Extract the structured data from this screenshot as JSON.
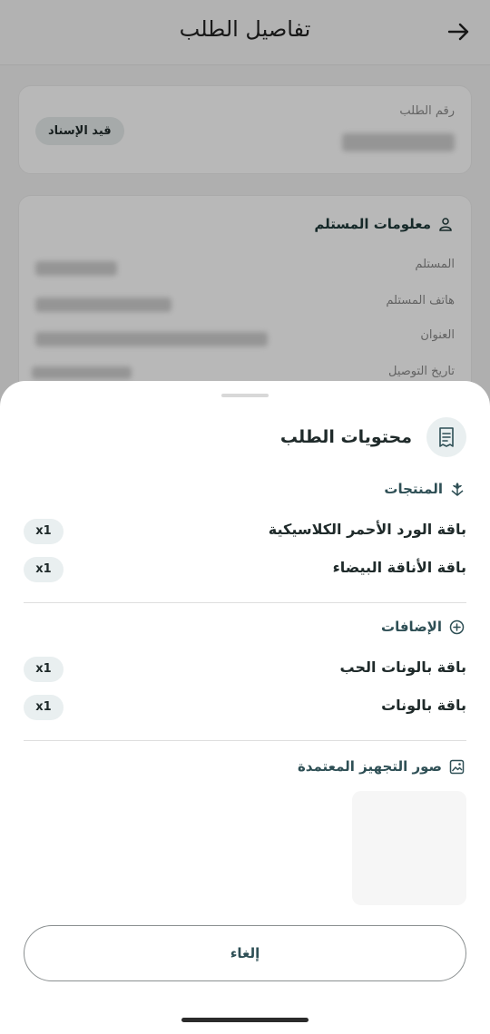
{
  "header": {
    "title": "تفاصيل الطلب",
    "back_icon": "arrow-right-icon"
  },
  "order_card": {
    "order_number_label": "رقم الطلب",
    "status": "قيد الإسناد"
  },
  "recipient_card": {
    "title": "معلومات المستلم",
    "icon": "user-icon",
    "fields": [
      {
        "label": "المستلم"
      },
      {
        "label": "هاتف المستلم"
      },
      {
        "label": "العنوان"
      },
      {
        "label": "تاريخ التوصيل"
      }
    ]
  },
  "sheet": {
    "title": "محتويات الطلب",
    "title_icon": "receipt-icon",
    "products": {
      "heading": "المنتجات",
      "icon": "flower-icon",
      "items": [
        {
          "name": "باقة الورد الأحمر الكلاسيكية",
          "qty": "x1"
        },
        {
          "name": "باقة الأناقة البيضاء",
          "qty": "x1"
        }
      ]
    },
    "addons": {
      "heading": "الإضافات",
      "icon": "plus-circle-icon",
      "items": [
        {
          "name": "باقة بالونات الحب",
          "qty": "x1"
        },
        {
          "name": "باقة بالونات",
          "qty": "x1"
        }
      ]
    },
    "photos": {
      "heading": "صور التجهيز المعتمدة",
      "icon": "image-icon"
    },
    "cancel_label": "إلغاء"
  },
  "colors": {
    "accent": "#2e4f55",
    "pill_bg": "#e9eff0",
    "overlay": "rgba(0,0,0,0.28)"
  }
}
